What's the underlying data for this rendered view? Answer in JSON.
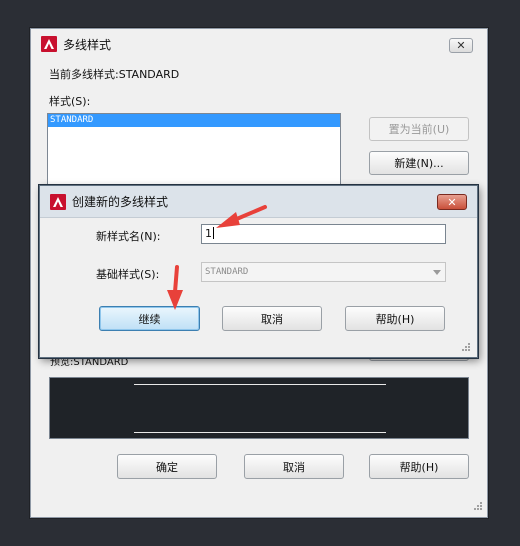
{
  "outer": {
    "title": "多线样式",
    "current_style_label": "当前多线样式:STANDARD",
    "styles_label": "样式(S):",
    "styles": [
      "STANDARD"
    ],
    "set_current_button": "置为当前(U)",
    "new_button": "新建(N)...",
    "preview_label": "预览:STANDARD",
    "ok_button": "确定",
    "cancel_button": "取消",
    "help_button": "帮助(H)",
    "close_glyph": "✕"
  },
  "inner": {
    "title": "创建新的多线样式",
    "name_label": "新样式名(N):",
    "name_value": "1",
    "base_label": "基础样式(S):",
    "base_value": "STANDARD",
    "continue_button": "继续",
    "cancel_button": "取消",
    "help_button": "帮助(H)",
    "close_glyph": "✕"
  },
  "colors": {
    "background": "#2b2e35",
    "dialog": "#f0f0f0",
    "selection": "#3399ff",
    "annotation_arrow": "#e8413a",
    "app_icon_red": "#c8102e"
  },
  "icons": [
    "autocad-app-icon",
    "close-icon",
    "dropdown-arrow-icon",
    "resize-grip-icon"
  ]
}
